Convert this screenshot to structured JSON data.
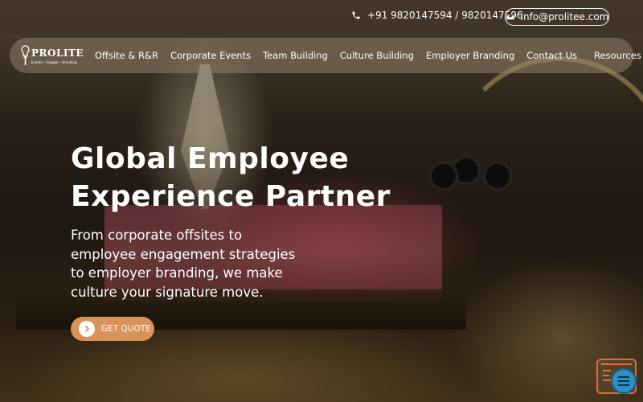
{
  "topbar": {
    "phone": "+91 9820147594 / 9820147596",
    "email": "info@prolitee.com"
  },
  "logo": {
    "name": "PROLITE",
    "tagline": "Events • Engage • Branding"
  },
  "nav": {
    "items": [
      {
        "label": "Offsite & R&R"
      },
      {
        "label": "Corporate Events"
      },
      {
        "label": "Team Building"
      },
      {
        "label": "Culture Building"
      },
      {
        "label": "Employer Branding"
      },
      {
        "label": "Contact Us"
      },
      {
        "label": "Resources"
      }
    ]
  },
  "hero": {
    "title_line1": "Global Employee",
    "title_line2": "Experience Partner",
    "subtitle": "From corporate offsites to employee engagement strategies to employer branding, we make culture your signature move.",
    "cta_label": "GET QUOTE"
  },
  "icons": {
    "phone": "phone-icon",
    "email": "envelope-icon",
    "cta": "chevron-right-icon",
    "chat": "chat-icon"
  },
  "colors": {
    "cta": "#d9925a",
    "widget_accent": "#e36c36",
    "chat_bubble": "#2f8fc2"
  }
}
